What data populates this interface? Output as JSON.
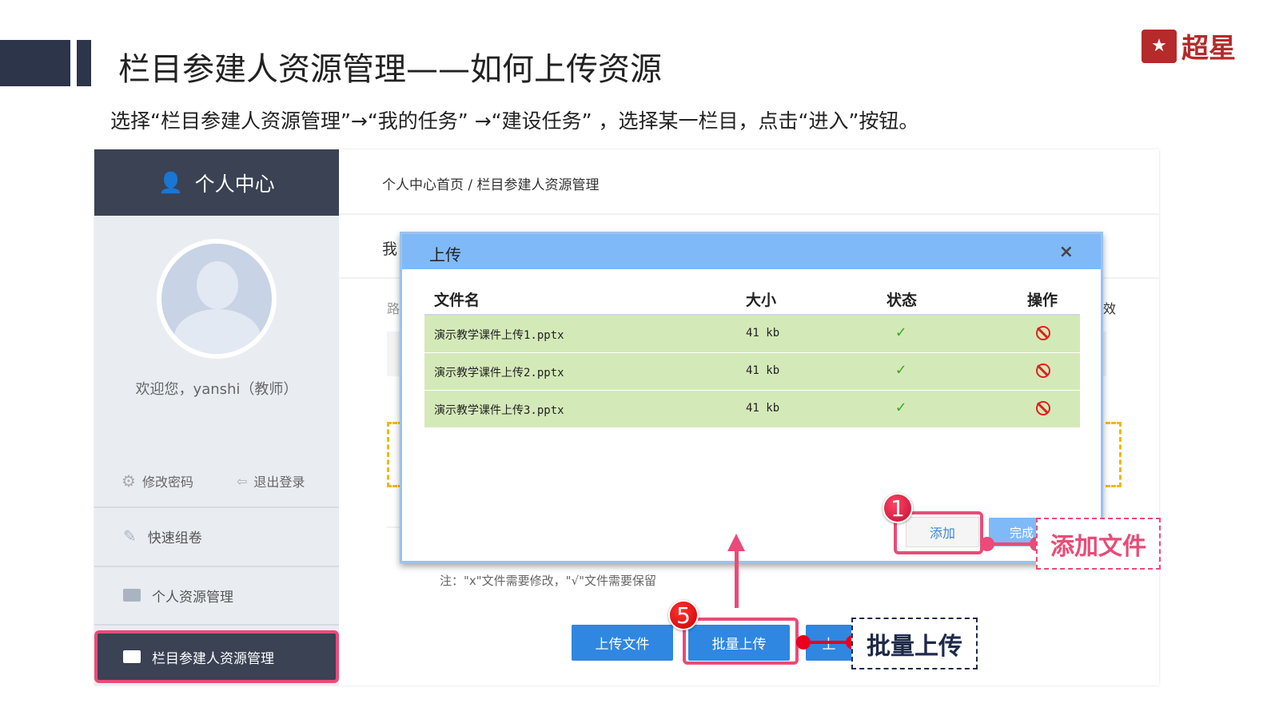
{
  "slide": {
    "title": "栏目参建人资源管理——如何上传资源",
    "subtitle": "选择“栏目参建人资源管理”→“我的任务” →“建设任务” ，选择某一栏目，点击“进入”按钮。",
    "logo_text": "超星"
  },
  "sidebar": {
    "header": "个人中心",
    "welcome": "欢迎您，yanshi（教师）",
    "change_password": "修改密码",
    "logout": "退出登录",
    "items": [
      {
        "label": "快速组卷"
      },
      {
        "label": "个人资源管理"
      },
      {
        "label": "栏目参建人资源管理"
      }
    ]
  },
  "main": {
    "breadcrumb": "个人中心首页 / 栏目参建人资源管理",
    "partial_tab": "我",
    "partial_path": "路",
    "partial_right": "效"
  },
  "dialog": {
    "title": "上传",
    "close": "×",
    "columns": [
      "文件名",
      "大小",
      "状态",
      "操作"
    ],
    "rows": [
      {
        "name": "演示教学课件上传1.pptx",
        "size": "41 kb",
        "status": "✓"
      },
      {
        "name": "演示教学课件上传2.pptx",
        "size": "41 kb",
        "status": "✓"
      },
      {
        "name": "演示教学课件上传3.pptx",
        "size": "41 kb",
        "status": "✓"
      }
    ],
    "add": "添加",
    "done": "完成"
  },
  "note": "注：\"x\"文件需要修改，\"√\"文件需要保留",
  "buttons": {
    "upload_file": "上传文件",
    "batch_upload": "批量上传",
    "third": "上"
  },
  "annotations": {
    "step1": "1",
    "step5": "5",
    "add_file": "添加文件",
    "batch_upload": "批量上传"
  },
  "colors": {
    "dark": "#2c3549",
    "accent_pink": "#ea4b78",
    "dialog_header": "#80b9f8",
    "button_blue": "#2f87e1",
    "row_green": "#d4e9b8"
  }
}
